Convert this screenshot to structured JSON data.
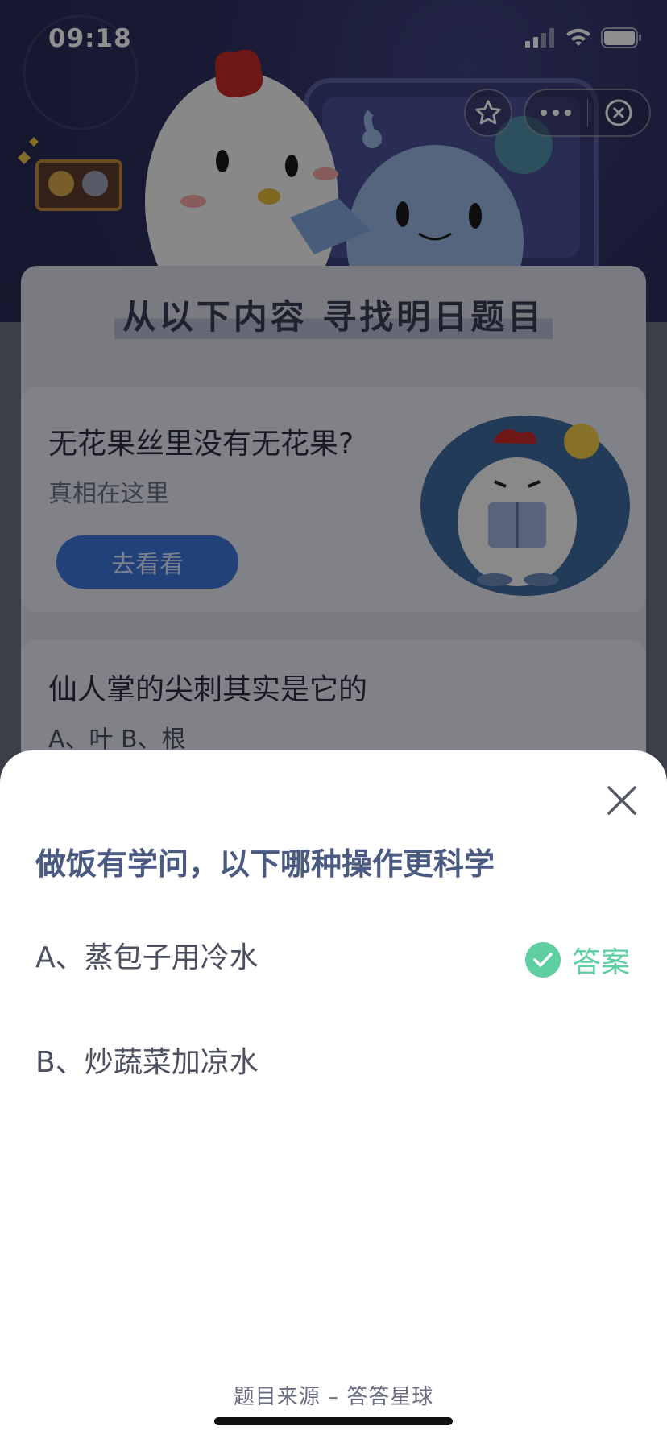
{
  "status_bar": {
    "time": "09:18"
  },
  "mini_program_capsule": {
    "favorite_icon": "star-icon",
    "more_icon": "more-dots-icon",
    "close_icon": "close-circle-icon"
  },
  "background": {
    "banner_title": "从以下内容 寻找明日题目",
    "card1": {
      "title": "无花果丝里没有无花果?",
      "subtitle": "真相在这里",
      "button_label": "去看看"
    },
    "card2": {
      "title": "仙人掌的尖刺其实是它的",
      "options": "A、叶    B、根"
    }
  },
  "sheet": {
    "question": "做饭有学问，以下哪种操作更科学",
    "options": [
      {
        "label": "A、蒸包子用冷水",
        "is_answer": true
      },
      {
        "label": "B、炒蔬菜加凉水",
        "is_answer": false
      }
    ],
    "answer_label": "答案",
    "source": "题目来源 – 答答星球",
    "colors": {
      "question": "#4a5a80",
      "answer": "#5ecfa0"
    }
  }
}
